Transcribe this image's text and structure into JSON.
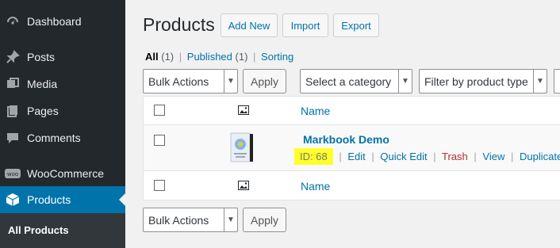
{
  "sidebar": {
    "items": [
      {
        "label": "Dashboard",
        "icon": "dashboard-icon"
      },
      {
        "label": "Posts",
        "icon": "pin-icon"
      },
      {
        "label": "Media",
        "icon": "media-icon"
      },
      {
        "label": "Pages",
        "icon": "pages-icon"
      },
      {
        "label": "Comments",
        "icon": "comment-icon"
      },
      {
        "label": "WooCommerce",
        "icon": "woo-icon"
      },
      {
        "label": "Products",
        "icon": "box-icon"
      }
    ],
    "submenu": {
      "label": "All Products"
    },
    "accent": "#0073aa"
  },
  "header": {
    "title": "Products",
    "buttons": {
      "add_new": "Add New",
      "import": "Import",
      "export": "Export"
    }
  },
  "views": {
    "all": "All",
    "all_count": "(1)",
    "published": "Published",
    "published_count": "(1)",
    "sorting": "Sorting",
    "separator": "|"
  },
  "filters": {
    "bulk_actions": "Bulk Actions",
    "apply": "Apply",
    "category": "Select a category",
    "product_type": "Filter by product type"
  },
  "table": {
    "name_header": "Name",
    "rows": [
      {
        "name": "Markbook Demo",
        "id_label": "ID: 68",
        "actions": [
          "Edit",
          "Quick Edit",
          "Trash",
          "View",
          "Duplicate"
        ]
      }
    ]
  },
  "bottom": {
    "bulk_actions": "Bulk Actions",
    "apply": "Apply"
  }
}
